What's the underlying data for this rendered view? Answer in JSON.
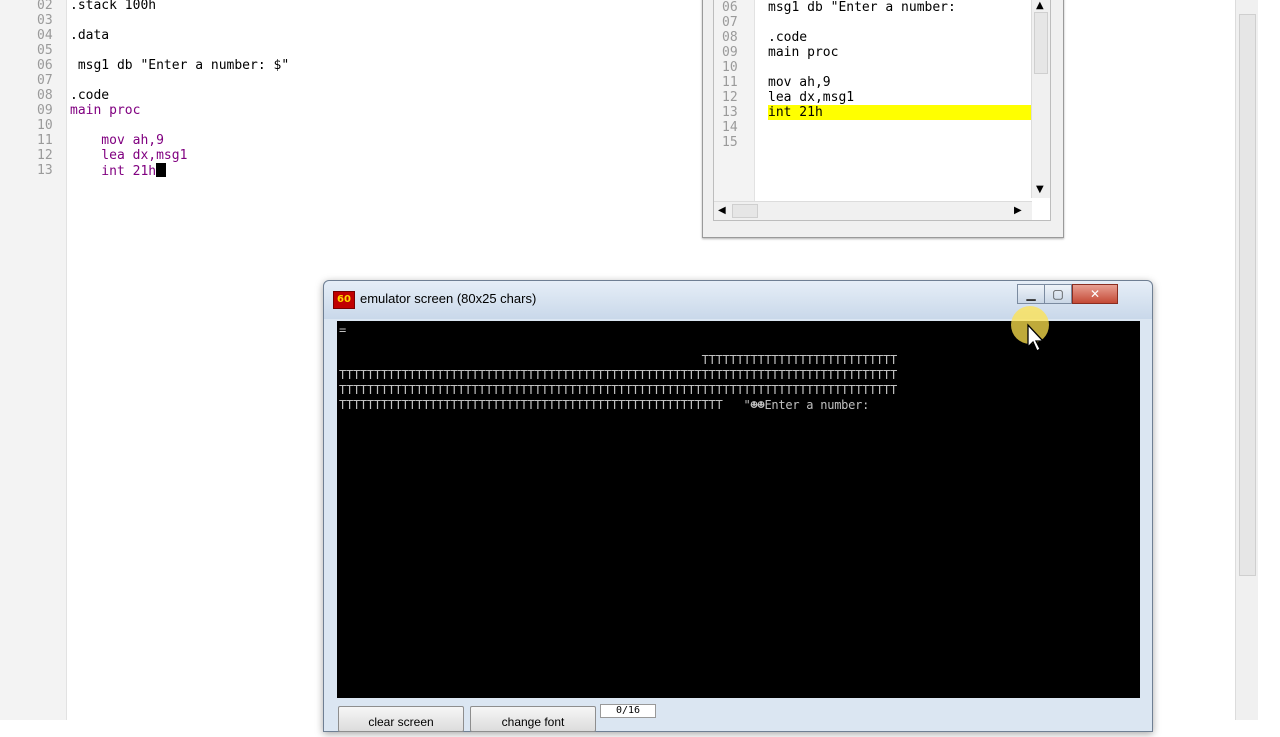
{
  "editor": {
    "lines": [
      {
        "num": "02",
        "text": ".stack 100h"
      },
      {
        "num": "03",
        "text": ""
      },
      {
        "num": "04",
        "text": ".data"
      },
      {
        "num": "05",
        "text": ""
      },
      {
        "num": "06",
        "text": " msg1 db \"Enter a number: $\""
      },
      {
        "num": "07",
        "text": ""
      },
      {
        "num": "08",
        "text": ".code"
      },
      {
        "num": "09",
        "text": "main proc"
      },
      {
        "num": "10",
        "text": ""
      },
      {
        "num": "11",
        "text": "    mov ah,9"
      },
      {
        "num": "12",
        "text": "    lea dx,msg1"
      },
      {
        "num": "13",
        "text": "    int 21h"
      }
    ]
  },
  "source_window": {
    "lines": [
      {
        "num": "06",
        "text": "msg1 db \"Enter a number:"
      },
      {
        "num": "07",
        "text": ""
      },
      {
        "num": "08",
        "text": ".code"
      },
      {
        "num": "09",
        "text": "main proc"
      },
      {
        "num": "10",
        "text": ""
      },
      {
        "num": "11",
        "text": "mov ah,9"
      },
      {
        "num": "12",
        "text": "lea dx,msg1"
      },
      {
        "num": "13",
        "text": "int 21h"
      },
      {
        "num": "14",
        "text": ""
      },
      {
        "num": "15",
        "text": ""
      }
    ],
    "highlighted_line": "13"
  },
  "emulator": {
    "title": "emulator screen (80x25 chars)",
    "icon_text": "60",
    "screen_lines": [
      "=",
      "",
      "                                                    TTTTTTTTTTTTTTTTTTTTTTTTTTTT",
      "TTTTTTTTTTTTTTTTTTTTTTTTTTTTTTTTTTTTTTTTTTTTTTTTTTTTTTTTTTTTTTTTTTTTTTTTTTTTTTTT",
      "TTTTTTTTTTTTTTTTTTTTTTTTTTTTTTTTTTTTTTTTTTTTTTTTTTTTTTTTTTTTTTTTTTTTTTTTTTTTTTTT",
      "TTTTTTTTTTTTTTTTTTTTTTTTTTTTTTTTTTTTTTTTTTTTTTTTTTTTTTT   \"☻☻Enter a number:"
    ],
    "buttons": {
      "clear": "clear screen",
      "font": "change font"
    },
    "progress": "0/16"
  },
  "colors": {
    "highlight": "#ffff00",
    "keyword": "#800080",
    "register": "#a00000"
  }
}
